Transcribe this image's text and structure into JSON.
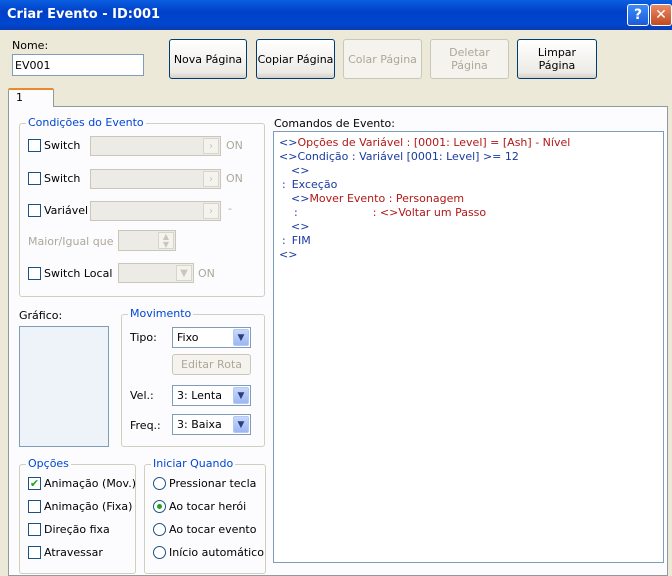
{
  "window": {
    "title": "Criar Evento - ID:001",
    "help_label": "?",
    "close_label": "✕"
  },
  "header": {
    "name_label": "Nome:",
    "name_value": "EV001",
    "buttons": {
      "new_page": "Nova Página",
      "copy_page": "Copiar Página",
      "paste_page": "Colar Página",
      "delete_page": "Deletar Página",
      "clear_page": "Limpar Página"
    }
  },
  "tabs": [
    {
      "label": "1"
    }
  ],
  "conditions": {
    "title": "Condições do Evento",
    "switch1_label": "Switch",
    "switch1_state": "ON",
    "switch2_label": "Switch",
    "switch2_state": "ON",
    "variable_label": "Variável",
    "variable_dash": "-",
    "greater_equal_label": "Maior/Igual que",
    "local_switch_label": "Switch Local",
    "local_switch_state": "ON"
  },
  "graphic": {
    "title": "Gráfico:"
  },
  "movement": {
    "title": "Movimento",
    "type_label": "Tipo:",
    "type_value": "Fixo",
    "edit_route_label": "Editar Rota",
    "speed_label": "Vel.:",
    "speed_value": "3: Lenta",
    "freq_label": "Freq.:",
    "freq_value": "3: Baixa"
  },
  "options": {
    "title": "Opções",
    "items": [
      {
        "label": "Animação (Mov.)",
        "checked": true
      },
      {
        "label": "Animação (Fixa)",
        "checked": false
      },
      {
        "label": "Direção fixa",
        "checked": false
      },
      {
        "label": "Atravessar",
        "checked": false
      }
    ]
  },
  "trigger": {
    "title": "Iniciar Quando",
    "items": [
      {
        "label": "Pressionar tecla",
        "selected": false
      },
      {
        "label": "Ao tocar herói",
        "selected": true
      },
      {
        "label": "Ao tocar evento",
        "selected": false
      },
      {
        "label": "Início automático",
        "selected": false
      }
    ]
  },
  "commands": {
    "title": "Comandos de Evento:",
    "lines": [
      {
        "prefix": "<>",
        "text": "Opções de Variável : [0001: Level] = [Ash] - Nível"
      },
      {
        "prefix": "<>",
        "text": "Condição : Variável [0001: Level] >= 12"
      },
      {
        "prefix": "<>",
        "text": ""
      },
      {
        "prefix": ":",
        "text": "Exceção"
      },
      {
        "prefix": "<>",
        "text": "Mover Evento : Personagem"
      },
      {
        "prefix": ":",
        "text": ": <>Voltar um Passo"
      },
      {
        "prefix": "<>",
        "text": ""
      },
      {
        "prefix": ":",
        "text": "FIM"
      },
      {
        "prefix": "<>",
        "text": ""
      }
    ]
  },
  "colors": {
    "title_bar": "#0040c8",
    "command_red": "#b01818",
    "command_blue": "#1a3aa0",
    "group_title": "#0046d5"
  }
}
